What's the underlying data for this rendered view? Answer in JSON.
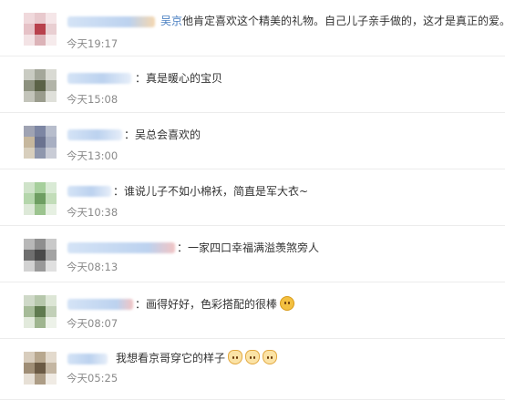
{
  "comments": [
    {
      "mention": "吴京",
      "text": "他肯定喜欢这个精美的礼物。自己儿子亲手做的，这才是真正的爱。",
      "time": "今天19:17"
    },
    {
      "text": "：真是暖心的宝贝",
      "time": "今天15:08"
    },
    {
      "text": "：吴总会喜欢的",
      "time": "今天13:00"
    },
    {
      "text": "：谁说儿子不如小棉袄，简直是军大衣~",
      "time": "今天10:38"
    },
    {
      "text": "：一家四口幸福满溢羡煞旁人",
      "time": "今天08:13"
    },
    {
      "text": "：画得好好，色彩搭配的很棒",
      "emoji": [
        "blush-face-icon"
      ],
      "time": "今天08:07"
    },
    {
      "text": "我想看京哥穿它的样子",
      "emoji": [
        "cat-face-icon",
        "cat-face-icon",
        "cat-face-icon"
      ],
      "time": "今天05:25"
    }
  ],
  "colors": {
    "mention": "#4a7fc1",
    "time": "#8a8a8a",
    "divider": "#ececec"
  }
}
